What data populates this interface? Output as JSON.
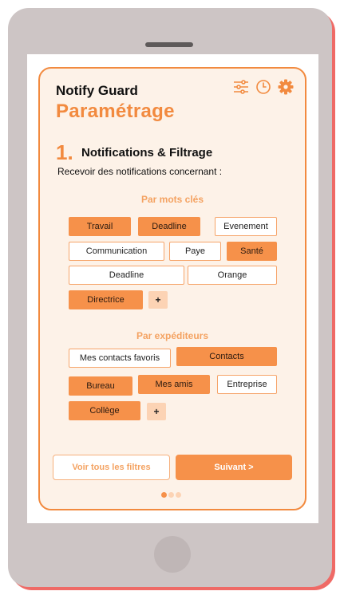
{
  "app": {
    "name": "Notify Guard",
    "page_title": "Paramétrage"
  },
  "toolbar": {
    "icons": [
      "sliders-icon",
      "clock-icon",
      "gear-icon"
    ]
  },
  "step": {
    "number": "1.",
    "title": "Notifications & Filtrage",
    "subtitle": "Recevoir des notifications concernant :"
  },
  "keywords": {
    "title": "Par mots clés",
    "chips": [
      {
        "label": "Travail",
        "selected": true
      },
      {
        "label": "Deadline",
        "selected": true
      },
      {
        "label": "Evenement",
        "selected": false
      },
      {
        "label": "Communication",
        "selected": false
      },
      {
        "label": "Paye",
        "selected": false
      },
      {
        "label": "Santé",
        "selected": true
      },
      {
        "label": "Deadline",
        "selected": false
      },
      {
        "label": "Orange",
        "selected": false
      },
      {
        "label": "Directrice",
        "selected": true
      }
    ],
    "add_label": "+"
  },
  "senders": {
    "title": "Par expéditeurs",
    "chips": [
      {
        "label": "Mes contacts favoris",
        "selected": false
      },
      {
        "label": "Contacts",
        "selected": true
      },
      {
        "label": "Bureau",
        "selected": true
      },
      {
        "label": "Mes amis",
        "selected": true
      },
      {
        "label": "Entreprise",
        "selected": false
      },
      {
        "label": "Collège",
        "selected": true
      }
    ],
    "add_label": "+"
  },
  "actions": {
    "secondary_label": "Voir tous les filtres",
    "primary_label": "Suivant >"
  },
  "pagination": {
    "total": 3,
    "current": 1
  },
  "colors": {
    "accent": "#f28a3f",
    "chip_selected": "#f6914a",
    "card_bg": "#fdf2e8",
    "frame": "#cdc5c5",
    "frame_shadow": "#ef6a66"
  }
}
